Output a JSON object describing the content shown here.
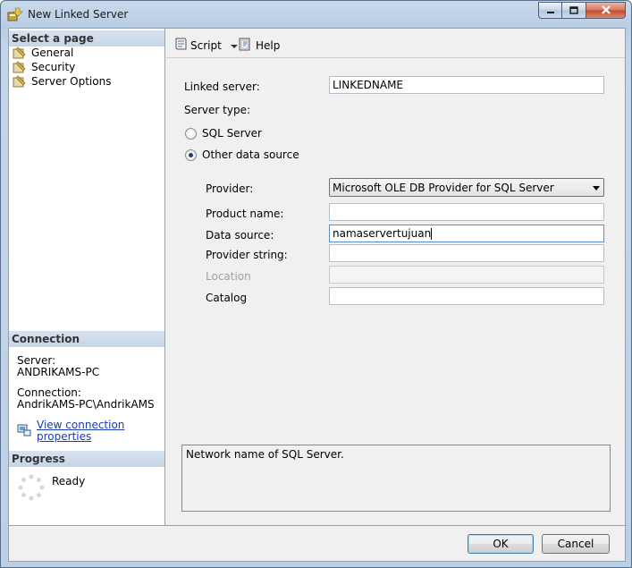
{
  "window": {
    "title": "New Linked Server"
  },
  "left": {
    "select_page_header": "Select a page",
    "pages": [
      {
        "label": "General",
        "selected": true
      },
      {
        "label": "Security",
        "selected": false
      },
      {
        "label": "Server Options",
        "selected": false
      }
    ],
    "connection_header": "Connection",
    "server_label": "Server:",
    "server_value": "ANDRIKAMS-PC",
    "connection_label": "Connection:",
    "connection_value": "AndrikAMS-PC\\AndrikAMS",
    "view_props_link": "View connection properties",
    "progress_header": "Progress",
    "progress_status": "Ready"
  },
  "toolbar": {
    "script_label": "Script",
    "help_label": "Help"
  },
  "form": {
    "linked_server_label": "Linked server:",
    "linked_server_value": "LINKEDNAME",
    "server_type_label": "Server type:",
    "radio_sql_server": "SQL Server",
    "radio_other": "Other data source",
    "selected_server_type": "Other data source",
    "provider_label": "Provider:",
    "provider_value": "Microsoft OLE DB Provider for SQL Server",
    "product_name_label": "Product name:",
    "product_name_value": "",
    "data_source_label": "Data source:",
    "data_source_value": "namaservertujuan",
    "provider_string_label": "Provider string:",
    "provider_string_value": "",
    "location_label": "Location",
    "location_value": "",
    "catalog_label": "Catalog",
    "catalog_value": ""
  },
  "description": "Network name of SQL Server.",
  "footer": {
    "ok_label": "OK",
    "cancel_label": "Cancel"
  },
  "colors": {
    "link": "#1a3cb5",
    "section_header_bg": "#c5d5e6",
    "window_frame": "#b8cde3"
  }
}
